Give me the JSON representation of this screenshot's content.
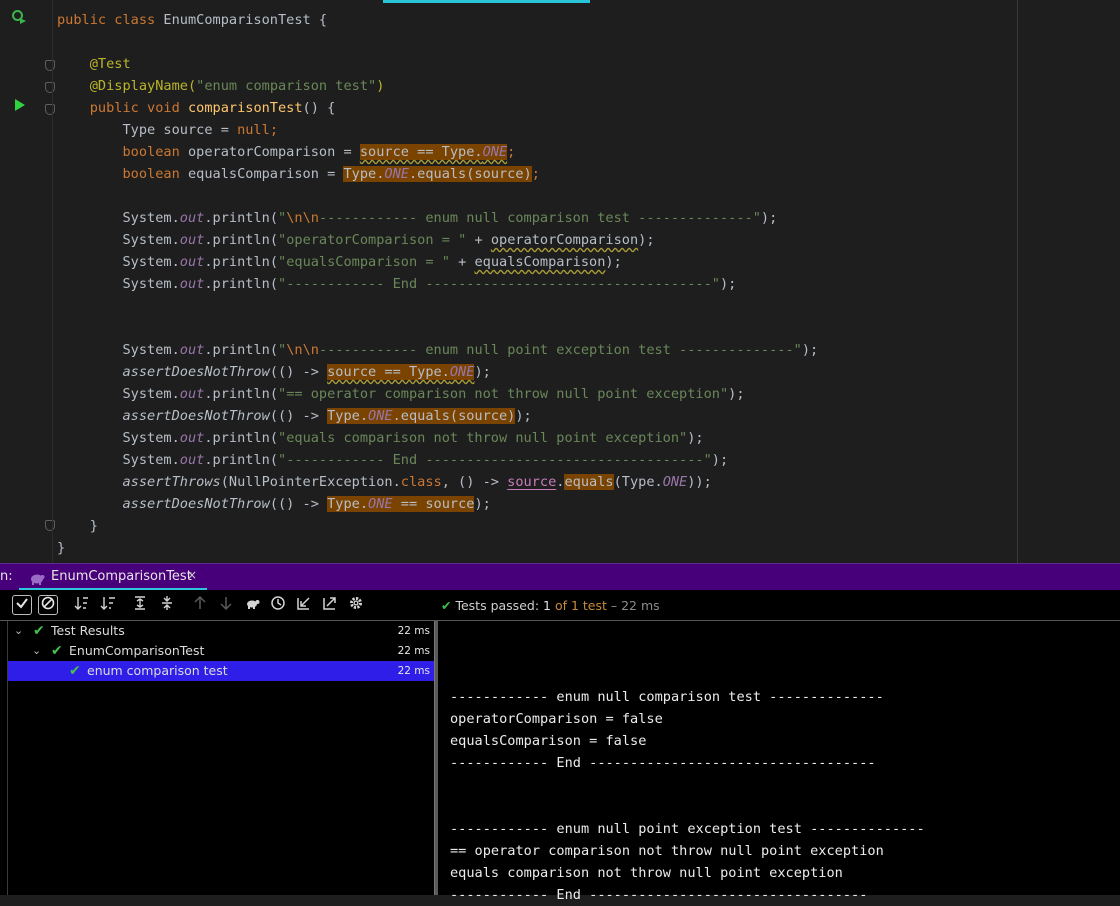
{
  "editor": {
    "lines": [
      [
        "public ",
        "class ",
        "EnumComparisonTest {"
      ],
      [],
      [
        "@Test"
      ],
      [
        "@DisplayName(",
        "\"enum comparison test\"",
        ")"
      ],
      [
        "public ",
        "void ",
        "comparisonTest",
        "() {"
      ],
      [
        "Type source = ",
        "null",
        ";"
      ],
      [
        "boolean ",
        "operatorComparison = ",
        "source == Type.",
        "ONE",
        ";"
      ],
      [
        "boolean ",
        "equalsComparison = ",
        "Type.",
        "ONE",
        ".equals(source)",
        ";"
      ],
      [],
      [
        "System.",
        "out",
        ".println(",
        "\"",
        "\\n\\n",
        "------------ enum null comparison test --------------\"",
        ");"
      ],
      [
        "System.",
        "out",
        ".println(",
        "\"operatorComparison = \"",
        " + ",
        "operatorComparison",
        ");"
      ],
      [
        "System.",
        "out",
        ".println(",
        "\"equalsComparison = \"",
        " + ",
        "equalsComparison",
        ");"
      ],
      [
        "System.",
        "out",
        ".println(",
        "\"------------ End -----------------------------------\"",
        ");"
      ],
      [],
      [],
      [
        "System.",
        "out",
        ".println(",
        "\"",
        "\\n\\n",
        "------------ enum null point exception test --------------\"",
        ");"
      ],
      [
        "assertDoesNotThrow",
        "(() -> ",
        "source == Type.",
        "ONE",
        ");"
      ],
      [
        "System.",
        "out",
        ".println(",
        "\"== operator comparison not throw null point exception\"",
        ");"
      ],
      [
        "assertDoesNotThrow",
        "(() -> ",
        "Type.",
        "ONE",
        ".equals(source)",
        ");"
      ],
      [
        "System.",
        "out",
        ".println(",
        "\"equals comparison not throw null point exception\"",
        ");"
      ],
      [
        "System.",
        "out",
        ".println(",
        "\"------------ End ----------------------------------\"",
        ");"
      ],
      [
        "assertThrows",
        "(NullPointerException.",
        "class",
        ", () -> ",
        "source",
        ".",
        "equals",
        "(Type.",
        "ONE",
        "));"
      ],
      [
        "assertDoesNotThrow",
        "(() -> ",
        "Type.",
        "ONE",
        " == source",
        ");"
      ],
      [
        "}"
      ],
      [
        "}"
      ]
    ]
  },
  "run": {
    "tab_prefix": "n:",
    "tab_label": "EnumComparisonTest",
    "tab_close": "×",
    "status": {
      "passed_label": "Tests passed: ",
      "passed_count": "1",
      "of_label": "of 1 test",
      "duration": "– 22 ms"
    },
    "tree": [
      {
        "label": "Test Results",
        "duration": "22 ms"
      },
      {
        "label": "EnumComparisonTest",
        "duration": "22 ms"
      },
      {
        "label": "enum comparison test",
        "duration": "22 ms"
      }
    ],
    "console": [
      "",
      "------------ enum null comparison test --------------",
      "operatorComparison = false",
      "equalsComparison = false",
      "------------ End -----------------------------------",
      "",
      "",
      "------------ enum null point exception test --------------",
      "== operator comparison not throw null point exception",
      "equals comparison not throw null point exception",
      "------------ End ----------------------------------"
    ]
  },
  "colors": {
    "tabbar": "#47007a",
    "selection": "#2f1ee8",
    "pass": "#44c24f",
    "highlight": "#7a4300"
  },
  "icons": {
    "run_class": "run-class-icon",
    "run_method": "run-method-icon",
    "show_passed": "checkmark-icon",
    "show_ignored": "cancel-icon",
    "sort_alpha": "sort-alphabetically-icon",
    "sort_duration": "sort-by-duration-icon",
    "expand_all": "expand-all-icon",
    "collapse_all": "collapse-all-icon",
    "prev": "arrow-up-icon",
    "next": "arrow-down-icon",
    "history": "test-history-icon",
    "import": "import-tests-icon",
    "export": "export-tests-icon",
    "settings": "gear-icon"
  }
}
